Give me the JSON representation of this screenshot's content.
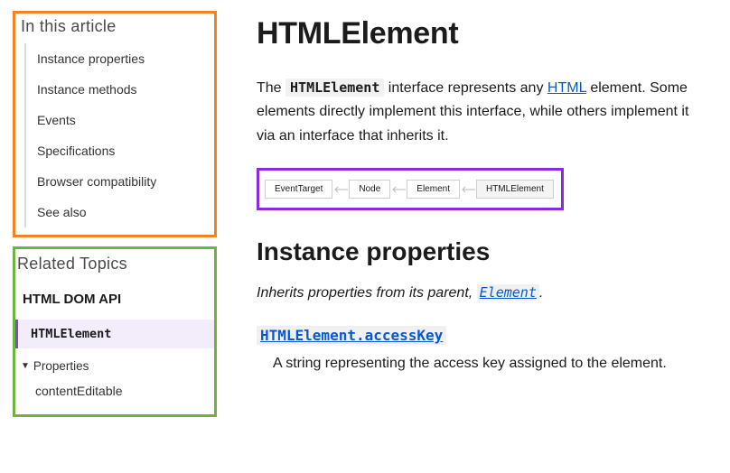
{
  "toc": {
    "title": "In this article",
    "items": [
      "Instance properties",
      "Instance methods",
      "Events",
      "Specifications",
      "Browser compatibility",
      "See also"
    ]
  },
  "related": {
    "title": "Related Topics",
    "api": "HTML DOM API",
    "current": "HTMLElement",
    "disclose_label": "Properties",
    "sub_items": [
      "contentEditable"
    ]
  },
  "article": {
    "title": "HTMLElement",
    "intro_pre": "The ",
    "intro_code": "HTMLElement",
    "intro_mid": " interface represents any ",
    "intro_link": "HTML",
    "intro_post": " element. Some elements directly implement this interface, while others implement it via an interface that inherits it.",
    "chain": [
      "EventTarget",
      "Node",
      "Element",
      "HTMLElement"
    ],
    "section_title": "Instance properties",
    "inherit_pre": "Inherits properties from its parent, ",
    "inherit_link": "Element",
    "inherit_post": ".",
    "prop_name": "HTMLElement.accessKey",
    "prop_desc": "A string representing the access key assigned to the element."
  }
}
